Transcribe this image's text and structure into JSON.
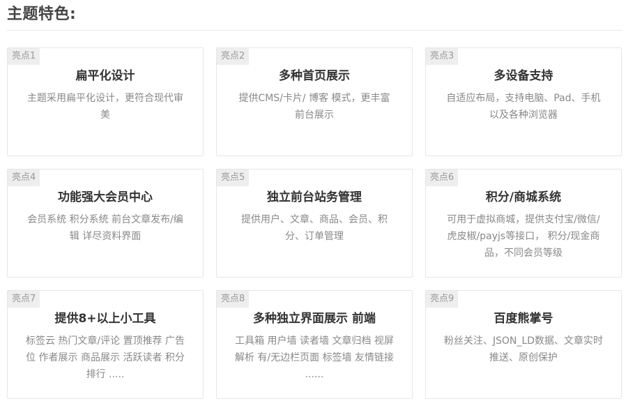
{
  "section": {
    "title": "主题特色:"
  },
  "cards": [
    {
      "badge": "亮点1",
      "title": "扁平化设计",
      "desc": "主题采用扁平化设计，更符合现代审美"
    },
    {
      "badge": "亮点2",
      "title": "多种首页展示",
      "desc": "提供CMS/卡片/ 博客 模式，更丰富前台展示"
    },
    {
      "badge": "亮点3",
      "title": "多设备支持",
      "desc": "自适应布局，支持电脑、Pad、手机以及各种浏览器"
    },
    {
      "badge": "亮点4",
      "title": "功能强大会员中心",
      "desc": "会员系统 积分系统 前台文章发布/编辑 详尽资料界面"
    },
    {
      "badge": "亮点5",
      "title": "独立前台站务管理",
      "desc": "提供用户、文章、商品、会员、积分、订单管理"
    },
    {
      "badge": "亮点6",
      "title": "积分/商城系统",
      "desc": "可用于虚拟商城，提供支付宝/微信/虎皮椒/payjs等接口， 积分/现金商品，不同会员等级"
    },
    {
      "badge": "亮点7",
      "title": "提供8+以上小工具",
      "desc": "标签云 热门文章/评论 置顶推荐 广告位 作者展示 商品展示 活跃读者 积分排行 ....."
    },
    {
      "badge": "亮点8",
      "title": "多种独立界面展示 前端",
      "desc": "工具箱 用户墙 读者墙 文章归档 视屏解析 有/无边栏页面 标签墙 友情链接 ......"
    },
    {
      "badge": "亮点9",
      "title": "百度熊掌号",
      "desc": "粉丝关注、JSON_LD数据、文章实时推送、原创保护"
    }
  ]
}
